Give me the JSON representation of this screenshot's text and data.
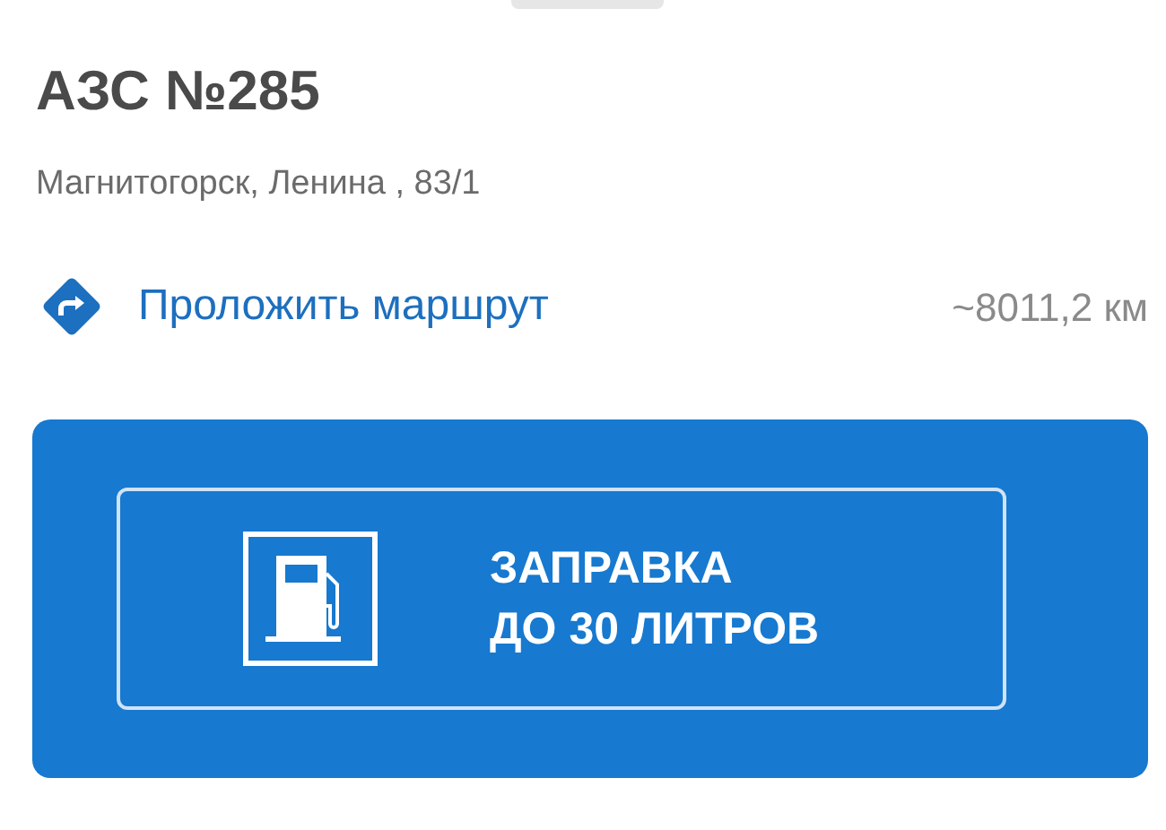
{
  "station": {
    "title": "АЗС №285",
    "address": "Магнитогорск, Ленина , 83/1"
  },
  "route": {
    "label": "Проложить маршрут",
    "distance": "~8011,2 км"
  },
  "banner": {
    "lines": [
      "ЗАПРАВКА",
      "ДО 30 ЛИТРОВ"
    ]
  }
}
